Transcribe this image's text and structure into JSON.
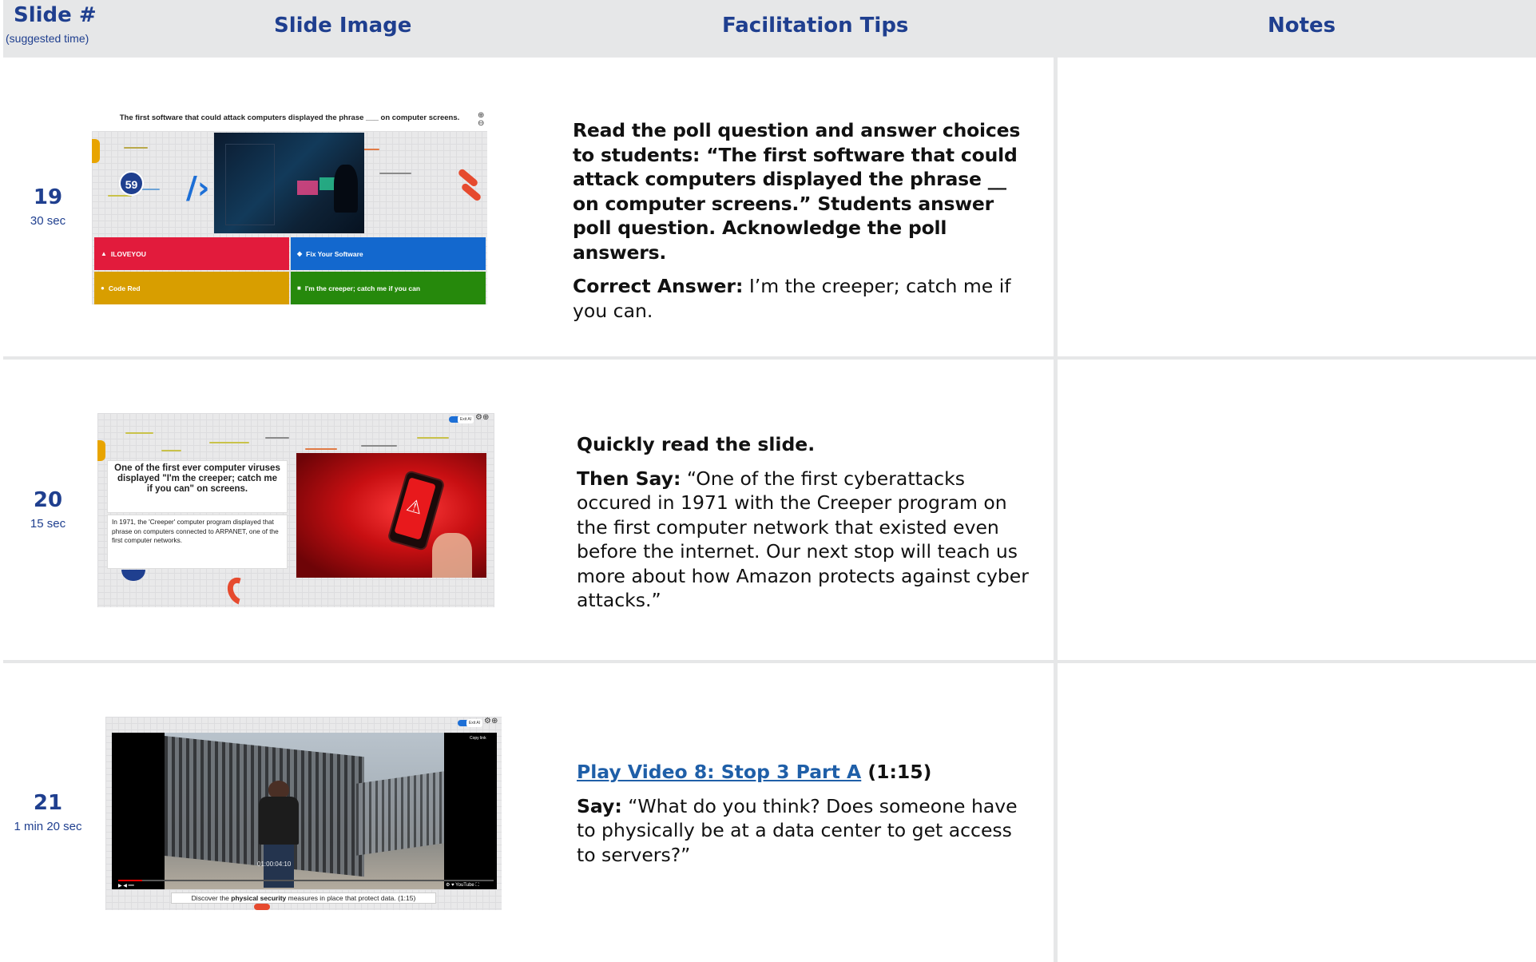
{
  "header": {
    "col1_title": "Slide #",
    "col1_sub": "(suggested time)",
    "col2_title": "Slide Image",
    "col3_title": "Facilitation Tips",
    "col4_title": "Notes"
  },
  "rows": [
    {
      "number": "19",
      "time": "30 sec",
      "slide": {
        "question": "The first software that could attack computers displayed the phrase ___ on computer screens.",
        "timer": "59",
        "options": [
          "ILOVEYOU",
          "Fix Your Software",
          "Code Red",
          "I'm the creeper; catch me if you can"
        ],
        "option_colors": [
          "#e21b3c",
          "#1368ce",
          "#d89e00",
          "#26890c"
        ]
      },
      "tips": {
        "para1": "Read the poll question and answer choices to students: “The first software that could attack computers displayed the phrase __ on computer screens.” Students answer poll question. Acknowledge the poll answers.",
        "label2": "Correct Answer:",
        "text2": " I’m the creeper; catch me if you can."
      }
    },
    {
      "number": "20",
      "time": "15 sec",
      "slide": {
        "heading": "One of the first ever computer viruses displayed \"I'm the creeper; catch me if you can\" on screens.",
        "body": "In 1971, the 'Creeper' computer program displayed that phrase on computers connected to ARPANET, one of the first computer networks.",
        "toggle_label": "Exit AI"
      },
      "tips": {
        "para1": "Quickly read the slide.",
        "label2": "Then Say:",
        "text2": " “One of the first cyberattacks occured in 1971 with the Creeper program on the first computer network that existed even before the internet. Our next stop will teach us more about how Amazon protects against cyber attacks.”"
      }
    },
    {
      "number": "21",
      "time": "1 min 20 sec",
      "slide": {
        "timecode": "01:00:04:10",
        "caption_pre": "Discover the ",
        "caption_bold": "physical security",
        "caption_post": " measures in place that protect data. (1:15)",
        "toggle_label": "Exit AI",
        "copy_link": "Copy link"
      },
      "tips": {
        "link": "Play Video 8: Stop 3 Part A",
        "duration": " (1:15)",
        "label2": "Say:",
        "text2": " “What do you think? Does someone have to physically be at a data center to get access to servers?”"
      }
    }
  ],
  "colors": {
    "header_bg": "#e6e7e8",
    "header_text": "#1f3f8f",
    "link": "#1f5fa8"
  }
}
